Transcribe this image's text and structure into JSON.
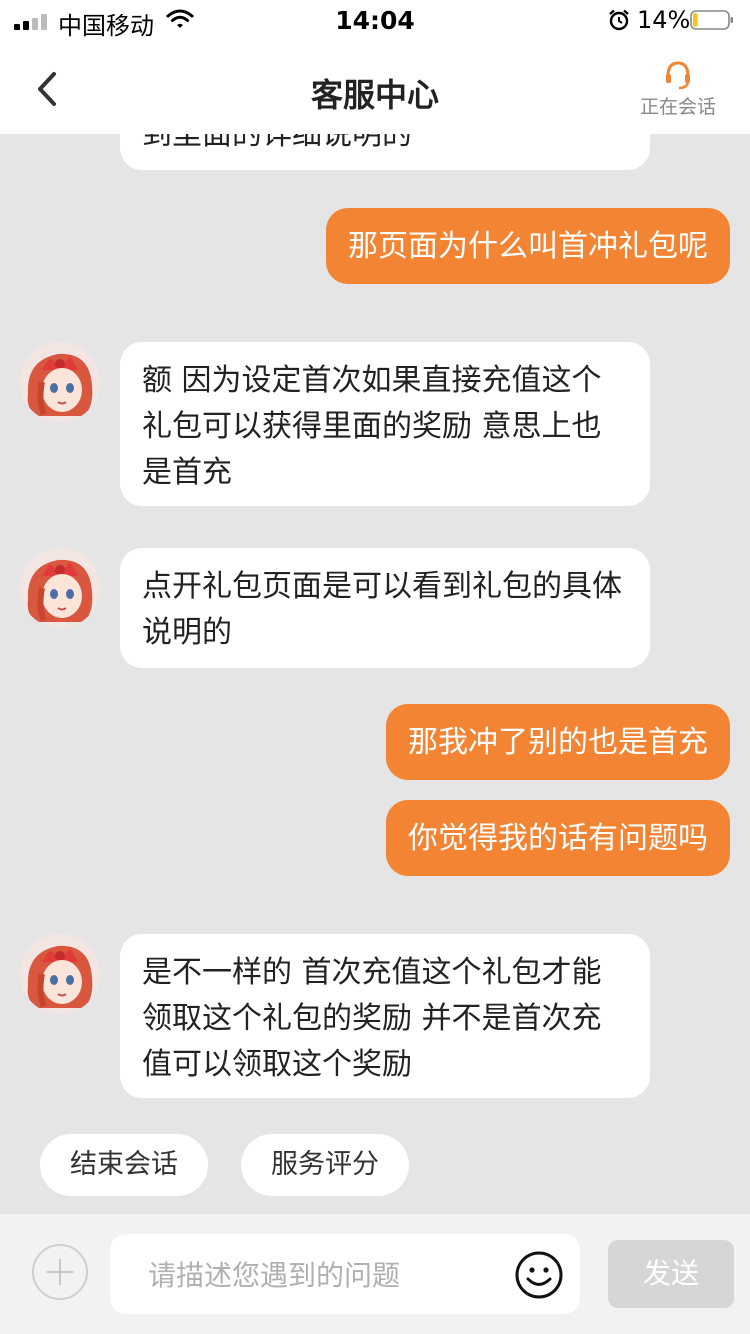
{
  "status_bar": {
    "carrier": "中国移动",
    "time": "14:04",
    "battery_percent": "14%",
    "battery_level": 0.14,
    "icons": [
      "signal-icon",
      "wifi-icon",
      "alarm-icon",
      "battery-icon"
    ]
  },
  "nav": {
    "title": "客服中心",
    "back_icon": "chevron-left-icon",
    "agent_status_icon": "headset-icon",
    "agent_status_label": "正在会话"
  },
  "messages": [
    {
      "sender": "agent",
      "text": "到里面的详细说明的"
    },
    {
      "sender": "user",
      "text": "那页面为什么叫首冲礼包呢"
    },
    {
      "sender": "agent",
      "text": "额 因为设定首次如果直接充值这个礼包可以获得里面的奖励 意思上也是首充"
    },
    {
      "sender": "agent",
      "text": "点开礼包页面是可以看到礼包的具体说明的"
    },
    {
      "sender": "user",
      "text": "那我冲了别的也是首充"
    },
    {
      "sender": "user",
      "text": "你觉得我的话有问题吗"
    },
    {
      "sender": "agent",
      "text": "是不一样的 首次充值这个礼包才能领取这个礼包的奖励 并不是首次充值可以领取这个奖励"
    }
  ],
  "quick_actions": {
    "end_session": "结束会话",
    "rate_service": "服务评分"
  },
  "input": {
    "placeholder": "请描述您遇到的问题",
    "value": "",
    "send_label": "发送",
    "plus_icon": "plus-circle-icon",
    "emoji_icon": "smiley-icon"
  },
  "colors": {
    "accent": "#f28434",
    "background": "#e5e5e5",
    "agent_bubble": "#ffffff",
    "send_disabled": "#d6d6d6"
  }
}
